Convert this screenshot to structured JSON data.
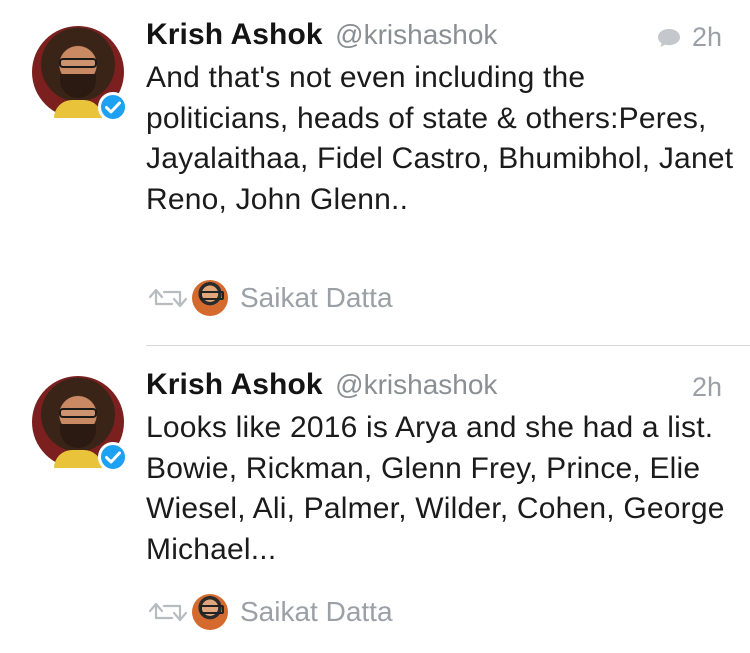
{
  "tweets": [
    {
      "author": {
        "name": "Krish Ashok",
        "handle": "@krishashok"
      },
      "time": "2h",
      "text": "And that's not even including the politicians, heads of state & others:Peres, Jayalaithaa, Fidel Castro, Bhumibhol, Janet Reno, John Glenn..",
      "has_reply_icon": true,
      "retweeted_by": "Saikat Datta"
    },
    {
      "author": {
        "name": "Krish Ashok",
        "handle": "@krishashok"
      },
      "time": "2h",
      "text": "Looks like 2016 is Arya and she had a list. Bowie, Rickman, Glenn Frey, Prince, Elie Wiesel, Ali, Palmer, Wilder, Cohen, George Michael...",
      "has_reply_icon": false,
      "retweeted_by": "Saikat Datta"
    }
  ],
  "icons": {
    "verified": "verified-badge-icon",
    "reply": "conversation-bubble-icon",
    "retweet": "retweet-icon"
  },
  "colors": {
    "verified_blue": "#1da1f2",
    "muted_text": "#9aa0a6",
    "divider": "#d8d8d8"
  }
}
